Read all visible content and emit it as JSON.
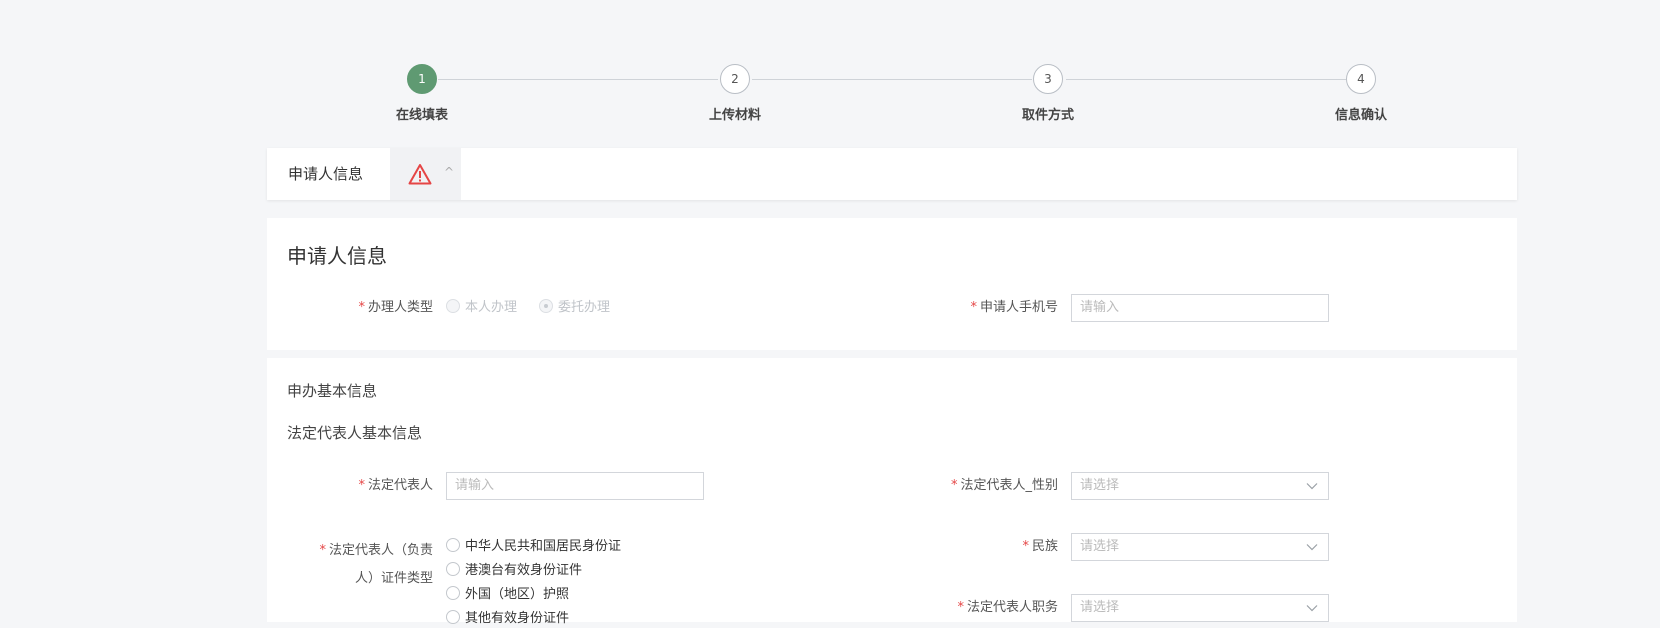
{
  "steps": [
    {
      "num": "1",
      "label": "在线填表",
      "active": true
    },
    {
      "num": "2",
      "label": "上传材料",
      "active": false
    },
    {
      "num": "3",
      "label": "取件方式",
      "active": false
    },
    {
      "num": "4",
      "label": "信息确认",
      "active": false
    }
  ],
  "tabbar": {
    "label": "申请人信息",
    "warning_icon": "warning-triangle-icon",
    "caret_icon": "chevron-up-icon",
    "caret_glyph": "^"
  },
  "applicant": {
    "title": "申请人信息",
    "handler_type": {
      "label": "办理人类型",
      "required_mark": "*",
      "options": [
        "本人办理",
        "委托办理"
      ]
    },
    "phone": {
      "label": "申请人手机号",
      "required_mark": "*",
      "placeholder": "请输入"
    }
  },
  "basic": {
    "title": "申办基本信息",
    "subtitle": "法定代表人基本信息",
    "legal_rep": {
      "label": "法定代表人",
      "required_mark": "*",
      "placeholder": "请输入"
    },
    "gender": {
      "label": "法定代表人_性别",
      "required_mark": "*",
      "placeholder": "请选择"
    },
    "id_type": {
      "label_line1": "法定代表人（负责",
      "label_line2": "人）证件类型",
      "required_mark": "*",
      "options": [
        "中华人民共和国居民身份证",
        "港澳台有效身份证件",
        "外国（地区）护照",
        "其他有效身份证件"
      ]
    },
    "ethnicity": {
      "label": "民族",
      "required_mark": "*",
      "placeholder": "请选择"
    },
    "position": {
      "label": "法定代表人职务",
      "required_mark": "*",
      "placeholder": "请选择"
    }
  },
  "colors": {
    "accent": "#5f9a72",
    "required": "#e54545",
    "warning": "#e54545"
  }
}
